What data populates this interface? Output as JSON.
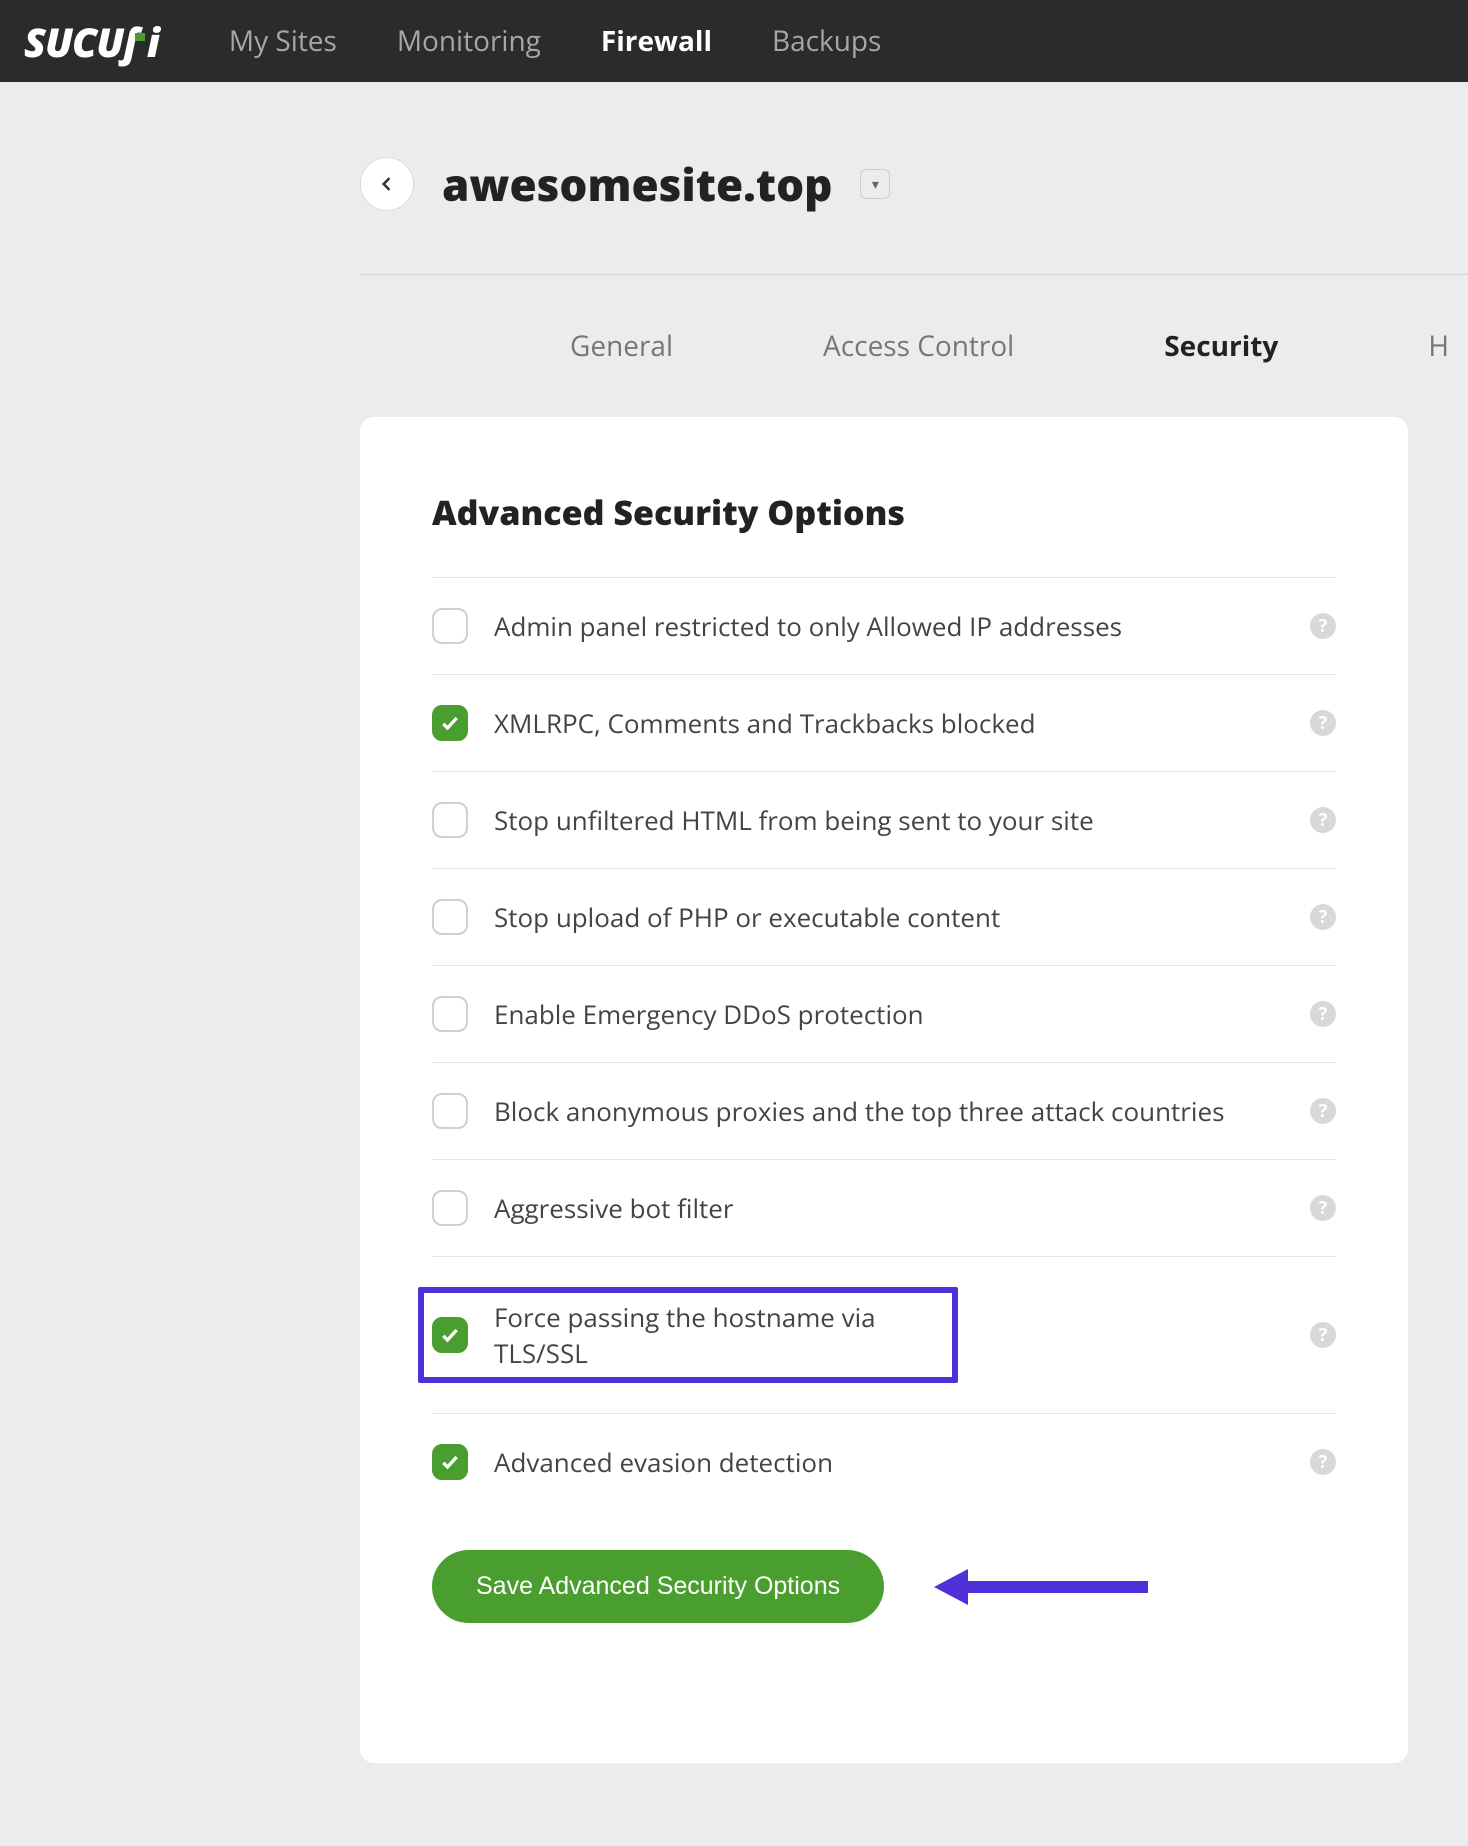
{
  "brand": {
    "name": "SUCURI"
  },
  "nav": {
    "items": [
      {
        "label": "My Sites",
        "active": false
      },
      {
        "label": "Monitoring",
        "active": false
      },
      {
        "label": "Firewall",
        "active": true
      },
      {
        "label": "Backups",
        "active": false
      }
    ]
  },
  "site": {
    "name": "awesomesite.top"
  },
  "tabs": {
    "items": [
      {
        "label": "General",
        "active": false
      },
      {
        "label": "Access Control",
        "active": false
      },
      {
        "label": "Security",
        "active": true
      },
      {
        "label": "HTTPS/SSL",
        "active": false,
        "truncated": "H"
      }
    ]
  },
  "panel": {
    "title": "Advanced Security Options",
    "options": [
      {
        "label": "Admin panel restricted to only Allowed IP addresses",
        "checked": false,
        "highlighted": false
      },
      {
        "label": "XMLRPC, Comments and Trackbacks blocked",
        "checked": true,
        "highlighted": false
      },
      {
        "label": "Stop unfiltered HTML from being sent to your site",
        "checked": false,
        "highlighted": false
      },
      {
        "label": "Stop upload of PHP or executable content",
        "checked": false,
        "highlighted": false
      },
      {
        "label": "Enable Emergency DDoS protection",
        "checked": false,
        "highlighted": false
      },
      {
        "label": "Block anonymous proxies and the top three attack countries",
        "checked": false,
        "highlighted": false
      },
      {
        "label": "Aggressive bot filter",
        "checked": false,
        "highlighted": false
      },
      {
        "label": "Force passing the hostname via TLS/SSL",
        "checked": true,
        "highlighted": true
      },
      {
        "label": "Advanced evasion detection",
        "checked": true,
        "highlighted": false
      }
    ],
    "save_label": "Save Advanced Security Options"
  },
  "colors": {
    "brand_green": "#4a9e2f",
    "annotation_purple": "#5030d8",
    "nav_bg": "#2b2b2b",
    "page_bg": "#ececec"
  }
}
